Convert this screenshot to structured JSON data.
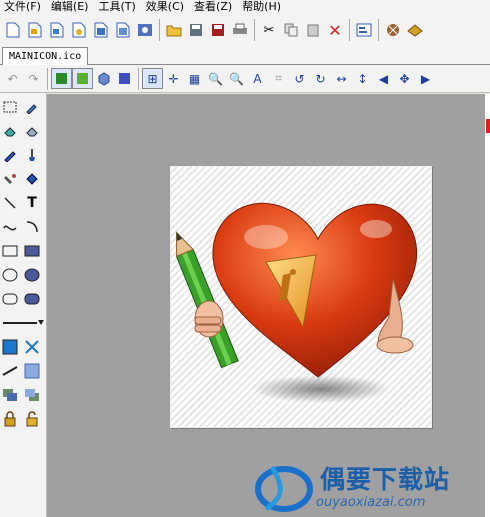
{
  "menubar": {
    "items": [
      {
        "label": "文件(F)"
      },
      {
        "label": "编辑(E)"
      },
      {
        "label": "工具(T)"
      },
      {
        "label": "效果(C)"
      },
      {
        "label": "查看(Z)"
      },
      {
        "label": "帮助(H)"
      }
    ]
  },
  "tabs": [
    {
      "label": "MAINICON.ico"
    }
  ],
  "watermark": {
    "title": "偶要下载站",
    "url": "ouyaoxiazai.com"
  },
  "colors": {
    "menu_bg": "#f3f3f3",
    "canvas_bg": "#a0a0a0",
    "heart": "#d8401a",
    "pencil": "#39a02a",
    "watermark_blue": "#1a5fa8"
  }
}
